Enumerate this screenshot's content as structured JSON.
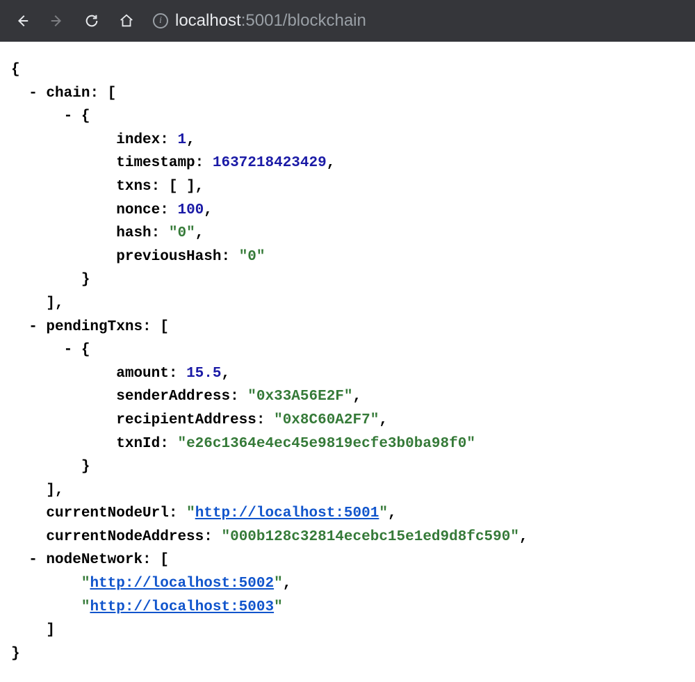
{
  "browser": {
    "url_host_bright": "localhost",
    "url_rest_dim": ":5001/blockchain"
  },
  "json": {
    "keys": {
      "chain": "chain",
      "index": "index",
      "timestamp": "timestamp",
      "txns": "txns",
      "nonce": "nonce",
      "hash": "hash",
      "previousHash": "previousHash",
      "pendingTxns": "pendingTxns",
      "amount": "amount",
      "senderAddress": "senderAddress",
      "recipientAddress": "recipientAddress",
      "txnId": "txnId",
      "currentNodeUrl": "currentNodeUrl",
      "currentNodeAddress": "currentNodeAddress",
      "nodeNetwork": "nodeNetwork"
    },
    "chain0": {
      "index": "1",
      "timestamp": "1637218423429",
      "nonce": "100",
      "hash": "\"0\"",
      "previousHash": "\"0\""
    },
    "pending0": {
      "amount": "15.5",
      "senderAddress": "\"0x33A56E2F\"",
      "recipientAddress": "\"0x8C60A2F7\"",
      "txnId": "\"e26c1364e4ec45e9819ecfe3b0ba98f0\""
    },
    "currentNodeUrl": "http://localhost:5001",
    "currentNodeAddress": "\"000b128c32814ecebc15e1ed9d8fc590\"",
    "nodeNetwork": [
      "http://localhost:5002",
      "http://localhost:5003"
    ]
  }
}
